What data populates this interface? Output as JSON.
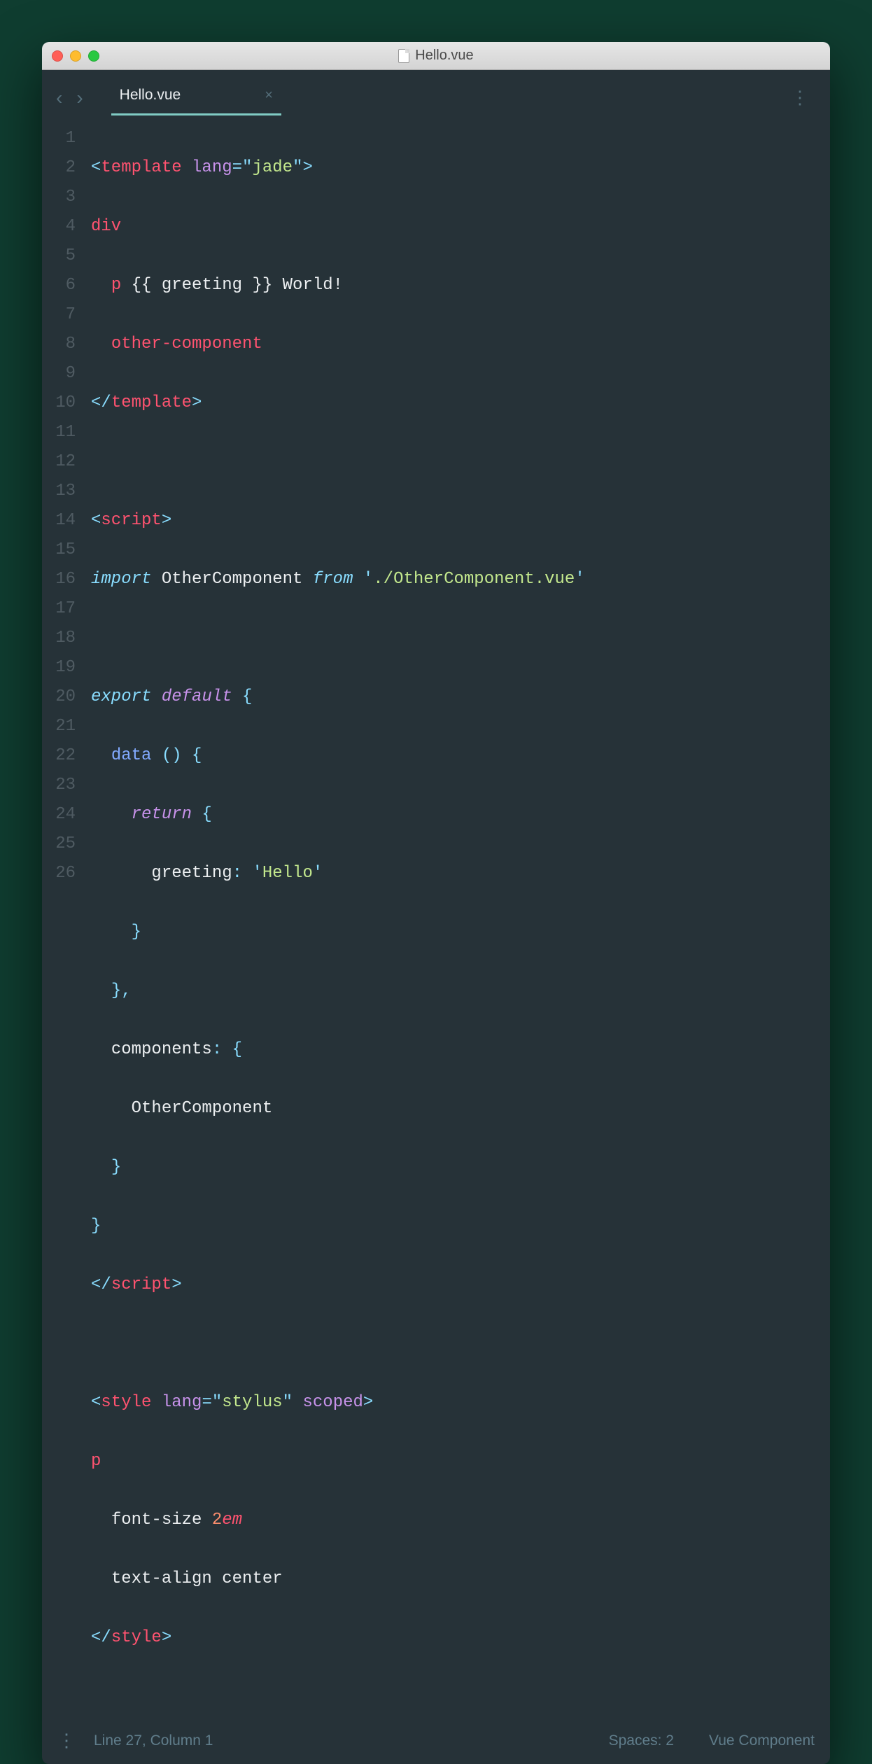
{
  "window": {
    "title": "Hello.vue"
  },
  "tab": {
    "name": "Hello.vue",
    "close": "×"
  },
  "gutter": [
    "1",
    "2",
    "3",
    "4",
    "5",
    "6",
    "7",
    "8",
    "9",
    "10",
    "11",
    "12",
    "13",
    "14",
    "15",
    "16",
    "17",
    "18",
    "19",
    "20",
    "21",
    "22",
    "23",
    "24",
    "25",
    "26"
  ],
  "code": {
    "l1": {
      "open": "<",
      "tag": "template",
      "sp": " ",
      "attr": "lang",
      "eq": "=",
      "q1": "\"",
      "val": "jade",
      "q2": "\"",
      "close": ">"
    },
    "l2": {
      "tag": "div"
    },
    "l3": {
      "tag": "p",
      "txt": " {{ greeting }} World!"
    },
    "l4": {
      "tag": "other-component"
    },
    "l5": {
      "open": "</",
      "tag": "template",
      "close": ">"
    },
    "l7": {
      "open": "<",
      "tag": "script",
      "close": ">"
    },
    "l8": {
      "kw1": "import",
      "id": " OtherComponent ",
      "kw2": "from",
      "sp": " ",
      "q1": "'",
      "str": "./OtherComponent.vue",
      "q2": "'"
    },
    "l10": {
      "kw1": "export",
      "sp": " ",
      "kw2": "default",
      "br": " {"
    },
    "l11": {
      "fn": "data",
      "args": " ()",
      "br": " {"
    },
    "l12": {
      "kw": "return",
      "br": " {"
    },
    "l13": {
      "key": "greeting",
      "colon": ":",
      "sp": " ",
      "q1": "'",
      "val": "Hello",
      "q2": "'"
    },
    "l14": {
      "br": "}"
    },
    "l15": {
      "br": "},",
      "brp": "}",
      "comma": ","
    },
    "l16": {
      "key": "components",
      "colon": ":",
      "br": " {"
    },
    "l17": {
      "id": "OtherComponent"
    },
    "l18": {
      "br": "}"
    },
    "l19": {
      "br": "}"
    },
    "l20": {
      "open": "</",
      "tag": "script",
      "close": ">"
    },
    "l22": {
      "open": "<",
      "tag": "style",
      "sp": " ",
      "attr1": "lang",
      "eq": "=",
      "q1": "\"",
      "val": "stylus",
      "q2": "\"",
      "sp2": " ",
      "attr2": "scoped",
      "close": ">"
    },
    "l23": {
      "sel": "p"
    },
    "l24": {
      "prop": "font-size ",
      "num": "2",
      "unit": "em"
    },
    "l25": {
      "prop": "text-align ",
      "val": "center"
    },
    "l26": {
      "open": "</",
      "tag": "style",
      "close": ">"
    }
  },
  "status": {
    "position": "Line 27, Column 1",
    "spaces": "Spaces: 2",
    "mode": "Vue Component"
  }
}
